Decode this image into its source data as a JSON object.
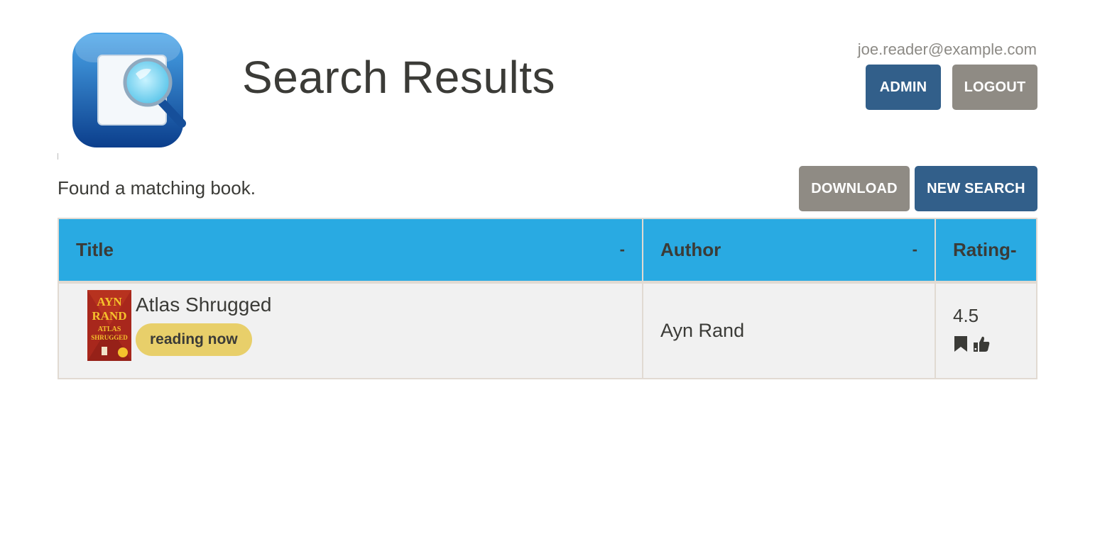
{
  "header": {
    "title": "Search Results",
    "user_email": "joe.reader@example.com",
    "admin_label": "ADMIN",
    "logout_label": "LOGOUT",
    "logo_icon": "magnifier-app-icon"
  },
  "results": {
    "status_text": "Found a matching book.",
    "download_label": "DOWNLOAD",
    "new_search_label": "NEW SEARCH"
  },
  "table": {
    "columns": [
      {
        "label": "Title",
        "sort": "-"
      },
      {
        "label": "Author",
        "sort": "-"
      },
      {
        "label": "Rating",
        "sort": "-"
      }
    ],
    "rows": [
      {
        "title": "Atlas Shrugged",
        "badge": "reading now",
        "author": "Ayn Rand",
        "rating": "4.5",
        "icons": [
          "bookmark-icon",
          "thumbs-up-icon"
        ],
        "cover_text": [
          "AYN",
          "RAND",
          "ATLAS",
          "SHRUGGED"
        ]
      }
    ]
  },
  "colors": {
    "header_blue": "#29aae2",
    "button_blue": "#325f8a",
    "button_gray": "#8f8b84",
    "badge_yellow": "#e8cf6a"
  }
}
